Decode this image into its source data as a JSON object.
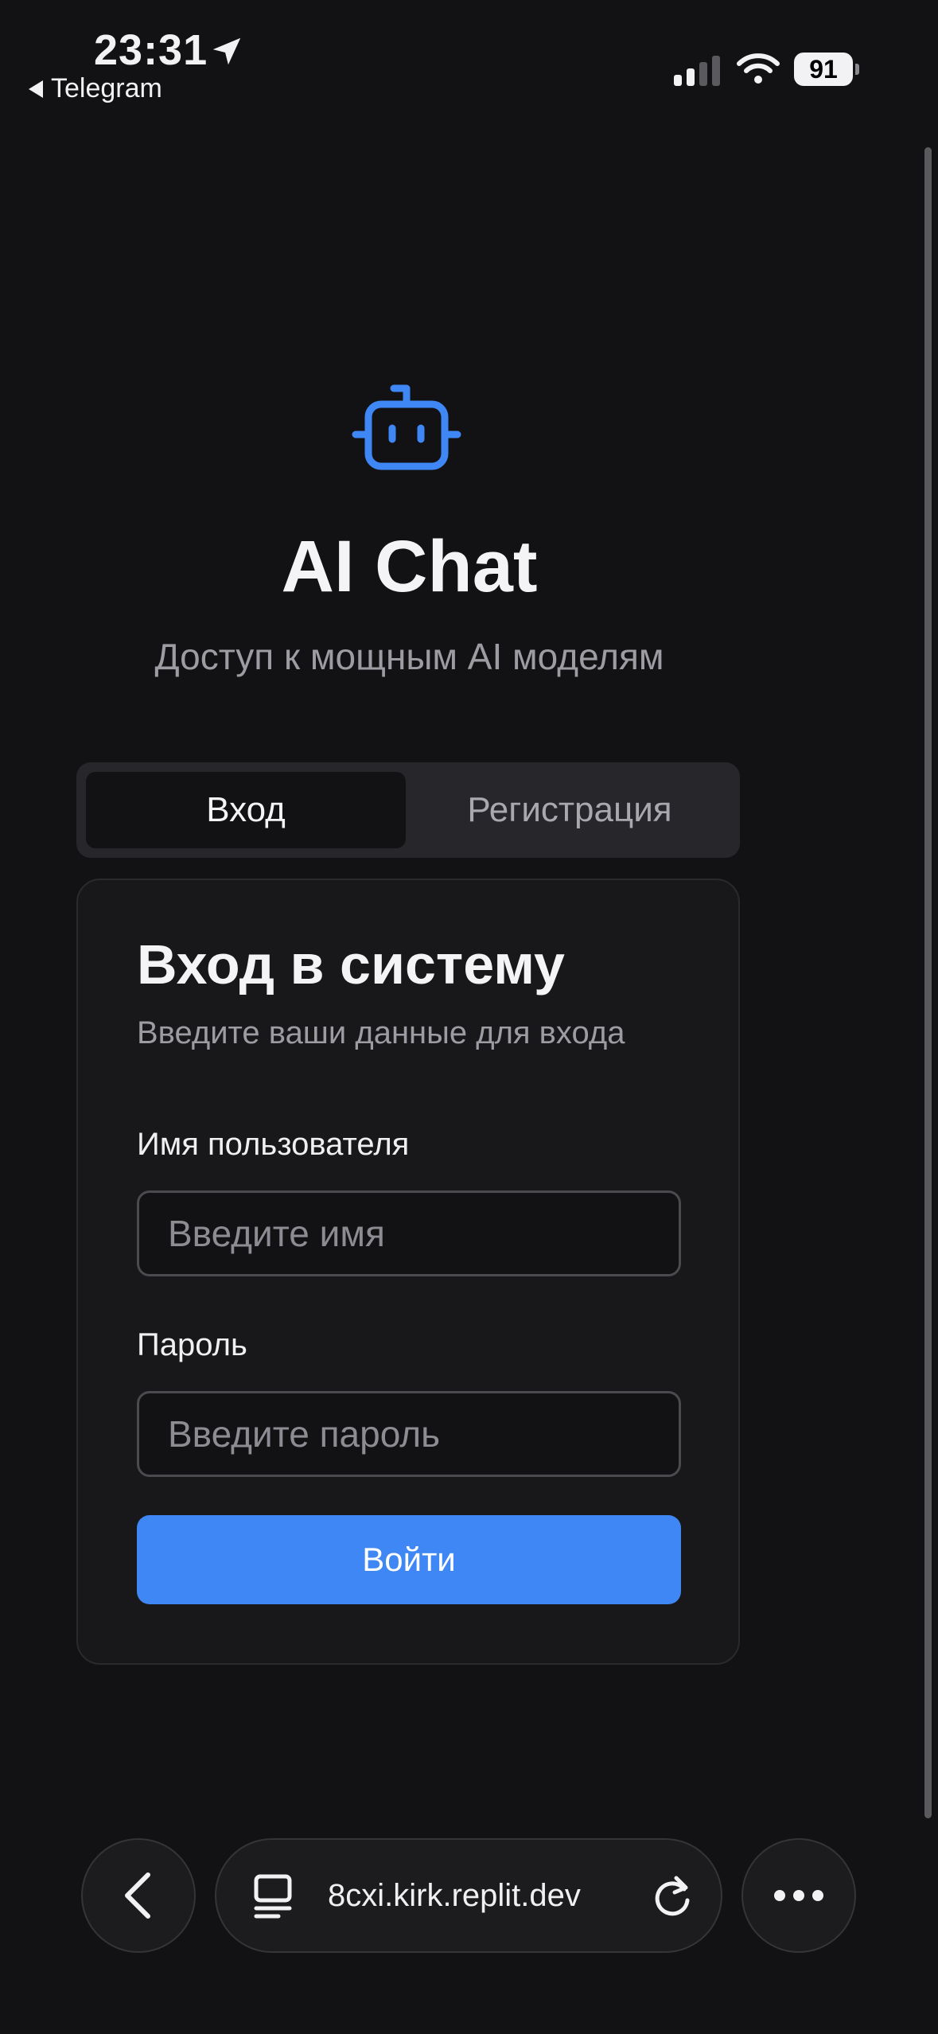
{
  "status_bar": {
    "time": "23:31",
    "back_app": "Telegram",
    "battery": "91",
    "icons": [
      "location-arrow-icon",
      "cellular-signal-icon",
      "wifi-icon",
      "battery-icon"
    ]
  },
  "hero": {
    "icon": "bot-icon",
    "title": "AI Chat",
    "subtitle": "Доступ к мощным AI моделям"
  },
  "tabs": [
    {
      "label": "Вход",
      "active": true
    },
    {
      "label": "Регистрация",
      "active": false
    }
  ],
  "login_card": {
    "title": "Вход в систему",
    "subtitle": "Введите ваши данные для входа",
    "username_label": "Имя пользователя",
    "username_placeholder": "Введите имя",
    "password_label": "Пароль",
    "password_placeholder": "Введите пароль",
    "submit_label": "Войти"
  },
  "browser_toolbar": {
    "url": "8cxi.kirk.replit.dev",
    "icons": [
      "chevron-left-icon",
      "reader-icon",
      "reload-icon",
      "more-icon"
    ]
  },
  "colors": {
    "background": "#121214",
    "accent": "#3f87f5",
    "card": "#18181b",
    "muted_text": "#9c9ca2"
  }
}
